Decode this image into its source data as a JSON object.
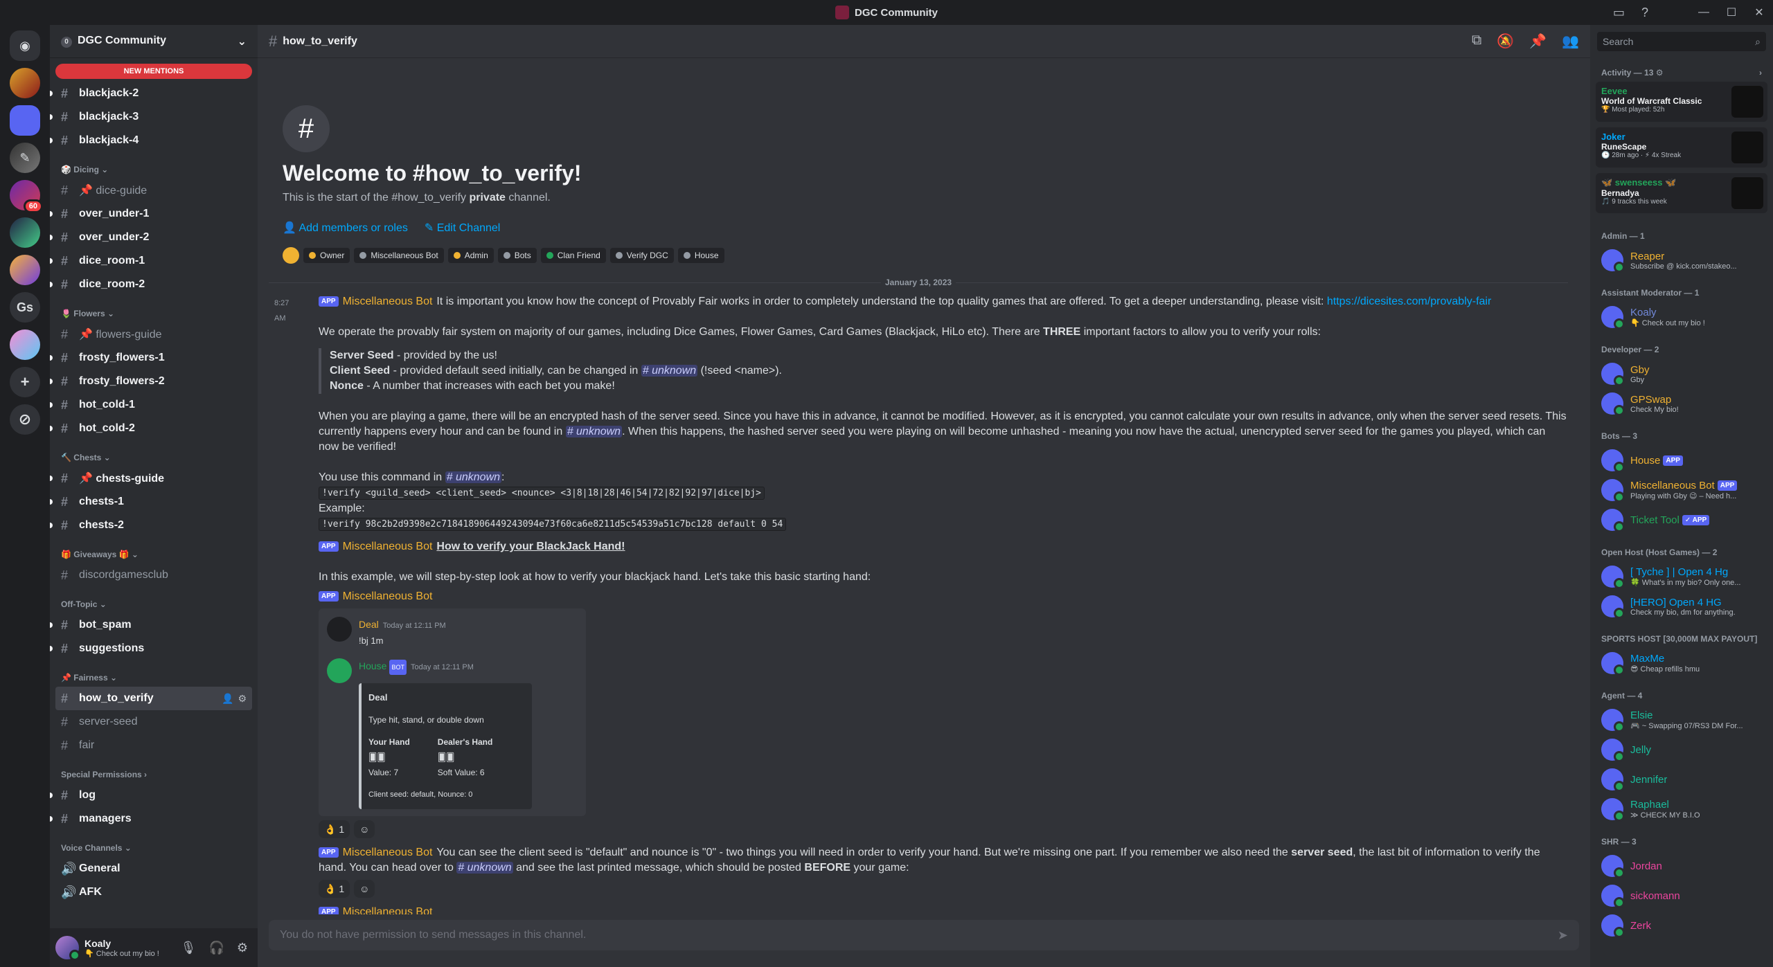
{
  "titlebar": {
    "title": "DGC Community"
  },
  "sidebar": {
    "server_name": "DGC Community",
    "level": "0",
    "new_mentions": "NEW MENTIONS",
    "channels": [
      {
        "type": "ch",
        "name": "blackjack-2",
        "unread": true
      },
      {
        "type": "ch",
        "name": "blackjack-3",
        "unread": true
      },
      {
        "type": "ch",
        "name": "blackjack-4",
        "unread": true
      },
      {
        "type": "cat",
        "name": "🎲 Dicing ⌄"
      },
      {
        "type": "ch",
        "name": "📌 dice-guide",
        "muted": true
      },
      {
        "type": "ch",
        "name": "over_under-1",
        "unread": true
      },
      {
        "type": "ch",
        "name": "over_under-2",
        "unread": true
      },
      {
        "type": "ch",
        "name": "dice_room-1",
        "unread": true
      },
      {
        "type": "ch",
        "name": "dice_room-2",
        "unread": true
      },
      {
        "type": "cat",
        "name": "🌷 Flowers ⌄"
      },
      {
        "type": "ch",
        "name": "📌 flowers-guide",
        "muted": true
      },
      {
        "type": "ch",
        "name": "frosty_flowers-1",
        "unread": true
      },
      {
        "type": "ch",
        "name": "frosty_flowers-2",
        "unread": true
      },
      {
        "type": "ch",
        "name": "hot_cold-1",
        "unread": true
      },
      {
        "type": "ch",
        "name": "hot_cold-2",
        "unread": true
      },
      {
        "type": "cat",
        "name": "🔨 Chests ⌄"
      },
      {
        "type": "ch",
        "name": "📌 chests-guide",
        "unread": true
      },
      {
        "type": "ch",
        "name": "chests-1",
        "unread": true
      },
      {
        "type": "ch",
        "name": "chests-2",
        "unread": true
      },
      {
        "type": "cat",
        "name": "🎁 Giveaways 🎁 ⌄"
      },
      {
        "type": "ch",
        "name": "discordgamesclub",
        "muted": true
      },
      {
        "type": "cat",
        "name": "Off-Topic ⌄"
      },
      {
        "type": "ch",
        "name": "bot_spam",
        "unread": true
      },
      {
        "type": "ch",
        "name": "suggestions",
        "unread": true
      },
      {
        "type": "cat",
        "name": "📌 Fairness ⌄"
      },
      {
        "type": "ch",
        "name": "how_to_verify",
        "active": true
      },
      {
        "type": "ch",
        "name": "server-seed",
        "muted": true
      },
      {
        "type": "ch",
        "name": "fair",
        "muted": true
      },
      {
        "type": "cat",
        "name": "Special Permissions ›"
      },
      {
        "type": "ch",
        "name": "log",
        "unread": true
      },
      {
        "type": "ch",
        "name": "managers",
        "unread": true
      },
      {
        "type": "cat",
        "name": "Voice Channels ⌄"
      },
      {
        "type": "voice",
        "name": "General"
      },
      {
        "type": "voice",
        "name": "AFK"
      }
    ]
  },
  "user": {
    "name": "Koaly",
    "status": "👇 Check out my bio !"
  },
  "channel": {
    "name": "how_to_verify",
    "welcome_title": "Welcome to #how_to_verify!",
    "welcome_desc_a": "This is the start of the #how_to_verify ",
    "welcome_desc_b": "private",
    "welcome_desc_c": " channel.",
    "add_members": "Add members or roles",
    "edit_channel": "Edit Channel",
    "roles": [
      {
        "name": "Owner",
        "color": "#f0b232"
      },
      {
        "name": "Miscellaneous Bot",
        "color": "#949ba4"
      },
      {
        "name": "Admin",
        "color": "#f0b232"
      },
      {
        "name": "Bots",
        "color": "#949ba4"
      },
      {
        "name": "Clan Friend",
        "color": "#23a55a"
      },
      {
        "name": "Verify DGC",
        "color": "#949ba4"
      },
      {
        "name": "House",
        "color": "#949ba4"
      }
    ],
    "date_divider": "January 13, 2023"
  },
  "messages": {
    "m1": {
      "time": "8:27 AM",
      "app": "APP",
      "author": "Miscellaneous Bot",
      "text": "It is important you know how the concept of Provably Fair works in order to completely understand the top quality games that are offered. To get a deeper understanding, please visit: ",
      "link": "https://dicesites.com/provably-fair",
      "p2a": "We operate the provably fair system on majority of our games, including Dice Games, Flower Games, Card Games (Blackjack, HiLo etc). There are ",
      "p2b": "THREE",
      "p2c": " important factors to allow you to verify your rolls:",
      "q1a": "Server Seed",
      "q1b": " - provided by the us!",
      "q2a": "Client Seed",
      "q2b": " - provided default seed initially, can be changed in ",
      "q2c": "# unknown",
      "q2d": " (!seed <name>).",
      "q3a": "Nonce",
      "q3b": " - A number that increases with each bet you make!",
      "p3a": "When you are playing a game, there will be an encrypted hash of the server seed. Since you have this in advance, it cannot be modified. However, as it is encrypted, you cannot calculate your own results in advance, only when the server seed resets. This currently happens every hour and can be found in ",
      "p3b": "# unknown",
      "p3c": ". When this happens, the hashed server seed you were playing on will become unhashed - meaning you now have the actual, unencrypted server seed for the games you played, which can now be verified!",
      "p4a": "You use this command in ",
      "p4b": "# unknown",
      "p4c": ":",
      "cmd": "!verify <guild_seed> <client_seed> <nounce> <3|8|18|28|46|54|72|82|92|97|dice|bj>",
      "example_label": "Example:",
      "example": "!verify 98c2b2d9398e2c718418906449243094e73f60ca6e8211d5c54539a51c7bc128 default 0 54"
    },
    "m2": {
      "app": "APP",
      "author": "Miscellaneous Bot",
      "title": "How to verify your BlackJack Hand!",
      "text": "In this example, we will step-by-step look at how to verify your blackjack hand. Let's take this basic starting hand:"
    },
    "m3": {
      "app": "APP",
      "author": "Miscellaneous Bot",
      "e_user": "Deal",
      "e_time": "Today at 12:11 PM",
      "e_cmd": "!bj 1m",
      "e_house": "House",
      "e_bot": "BOT",
      "e_time2": "Today at 12:11 PM",
      "e_title": "Deal",
      "e_type": "Type hit, stand, or double down",
      "e_your": "Your Hand",
      "e_your_val": "Value: 7",
      "e_dealer": "Dealer's Hand",
      "e_dealer_val": "Soft Value: 6",
      "e_seed": "Client seed: default, Nounce: 0",
      "reaction": "👌 1"
    },
    "m4": {
      "app": "APP",
      "author": "Miscellaneous Bot",
      "a": "You can see the client seed is \"default\" and nounce is \"0\" - two things you will need in order to verify your hand. But we're missing one part. If you remember we also need the ",
      "b": "server seed",
      "c": ", the last bit of information to verify the hand. You can head over to ",
      "d": "# unknown",
      "e": " and see the last printed message, which should be posted ",
      "f": "BEFORE",
      "g": " your game:",
      "reaction": "👌 1"
    },
    "m5": {
      "app": "APP",
      "author": "Miscellaneous Bot"
    }
  },
  "composer": {
    "placeholder": "You do not have permission to send messages in this channel."
  },
  "members": {
    "search": "Search",
    "activity_title": "Activity — 13 ⚙",
    "activities": [
      {
        "name": "Eevee",
        "color": "#23a55a",
        "game": "World of Warcraft Classic",
        "sub": "🏆 Most played: 52h"
      },
      {
        "name": "Joker",
        "color": "#00a8fc",
        "game": "RuneScape",
        "sub": "🕒 28m ago · ⚡ 4x Streak"
      },
      {
        "name": "🦋 swenseess 🦋",
        "color": "#23a55a",
        "game": "Bernadya",
        "sub": "🎵 9 tracks this week"
      }
    ],
    "groups": [
      {
        "title": "Admin — 1",
        "members": [
          {
            "name": "Reaper",
            "color": "#f0b232",
            "status": "Subscribe @ kick.com/stakeo..."
          }
        ]
      },
      {
        "title": "Assistant Moderator — 1",
        "members": [
          {
            "name": "Koaly",
            "color": "#7289da",
            "status": "👇 Check out my bio !"
          }
        ]
      },
      {
        "title": "Developer — 2",
        "members": [
          {
            "name": "Gby",
            "color": "#f0b232",
            "status": "Gby"
          },
          {
            "name": "GPSwap",
            "color": "#f0b232",
            "status": "Check My bio!"
          }
        ]
      },
      {
        "title": "Bots — 3",
        "members": [
          {
            "name": "House",
            "color": "#f0b232",
            "status": "",
            "app": "APP"
          },
          {
            "name": "Miscellaneous Bot",
            "color": "#f0b232",
            "status": "Playing with Gby 😉 – Need h...",
            "app": "APP"
          },
          {
            "name": "Ticket Tool",
            "color": "#23a55a",
            "status": "",
            "app": "✓ APP"
          }
        ]
      },
      {
        "title": "Open Host (Host Games) — 2",
        "members": [
          {
            "name": "[ Tyche ] | Open 4 Hg",
            "color": "#00a8fc",
            "status": "🍀 What's in my bio? Only one..."
          },
          {
            "name": "[HERO] Open 4 HG",
            "color": "#00a8fc",
            "status": "Check my bio, dm for anything."
          }
        ]
      },
      {
        "title": "SPORTS HOST [30,000M MAX PAYOUT]",
        "members": [
          {
            "name": "MaxMe",
            "color": "#00a8fc",
            "status": "😎 Cheap refills hmu"
          }
        ]
      },
      {
        "title": "Agent — 4",
        "members": [
          {
            "name": "Elsie",
            "color": "#1abc9c",
            "status": "🎮 ~ Swapping 07/RS3 DM For..."
          },
          {
            "name": "Jelly",
            "color": "#1abc9c",
            "status": ""
          },
          {
            "name": "Jennifer",
            "color": "#1abc9c",
            "status": ""
          },
          {
            "name": "Raphael",
            "color": "#1abc9c",
            "status": "≫ CHECK MY B.I.O"
          }
        ]
      },
      {
        "title": "SHR — 3",
        "members": [
          {
            "name": "Jordan",
            "color": "#eb459e",
            "status": ""
          },
          {
            "name": "sickomann",
            "color": "#eb459e",
            "status": ""
          },
          {
            "name": "Zerk",
            "color": "#eb459e",
            "status": ""
          }
        ]
      }
    ]
  }
}
